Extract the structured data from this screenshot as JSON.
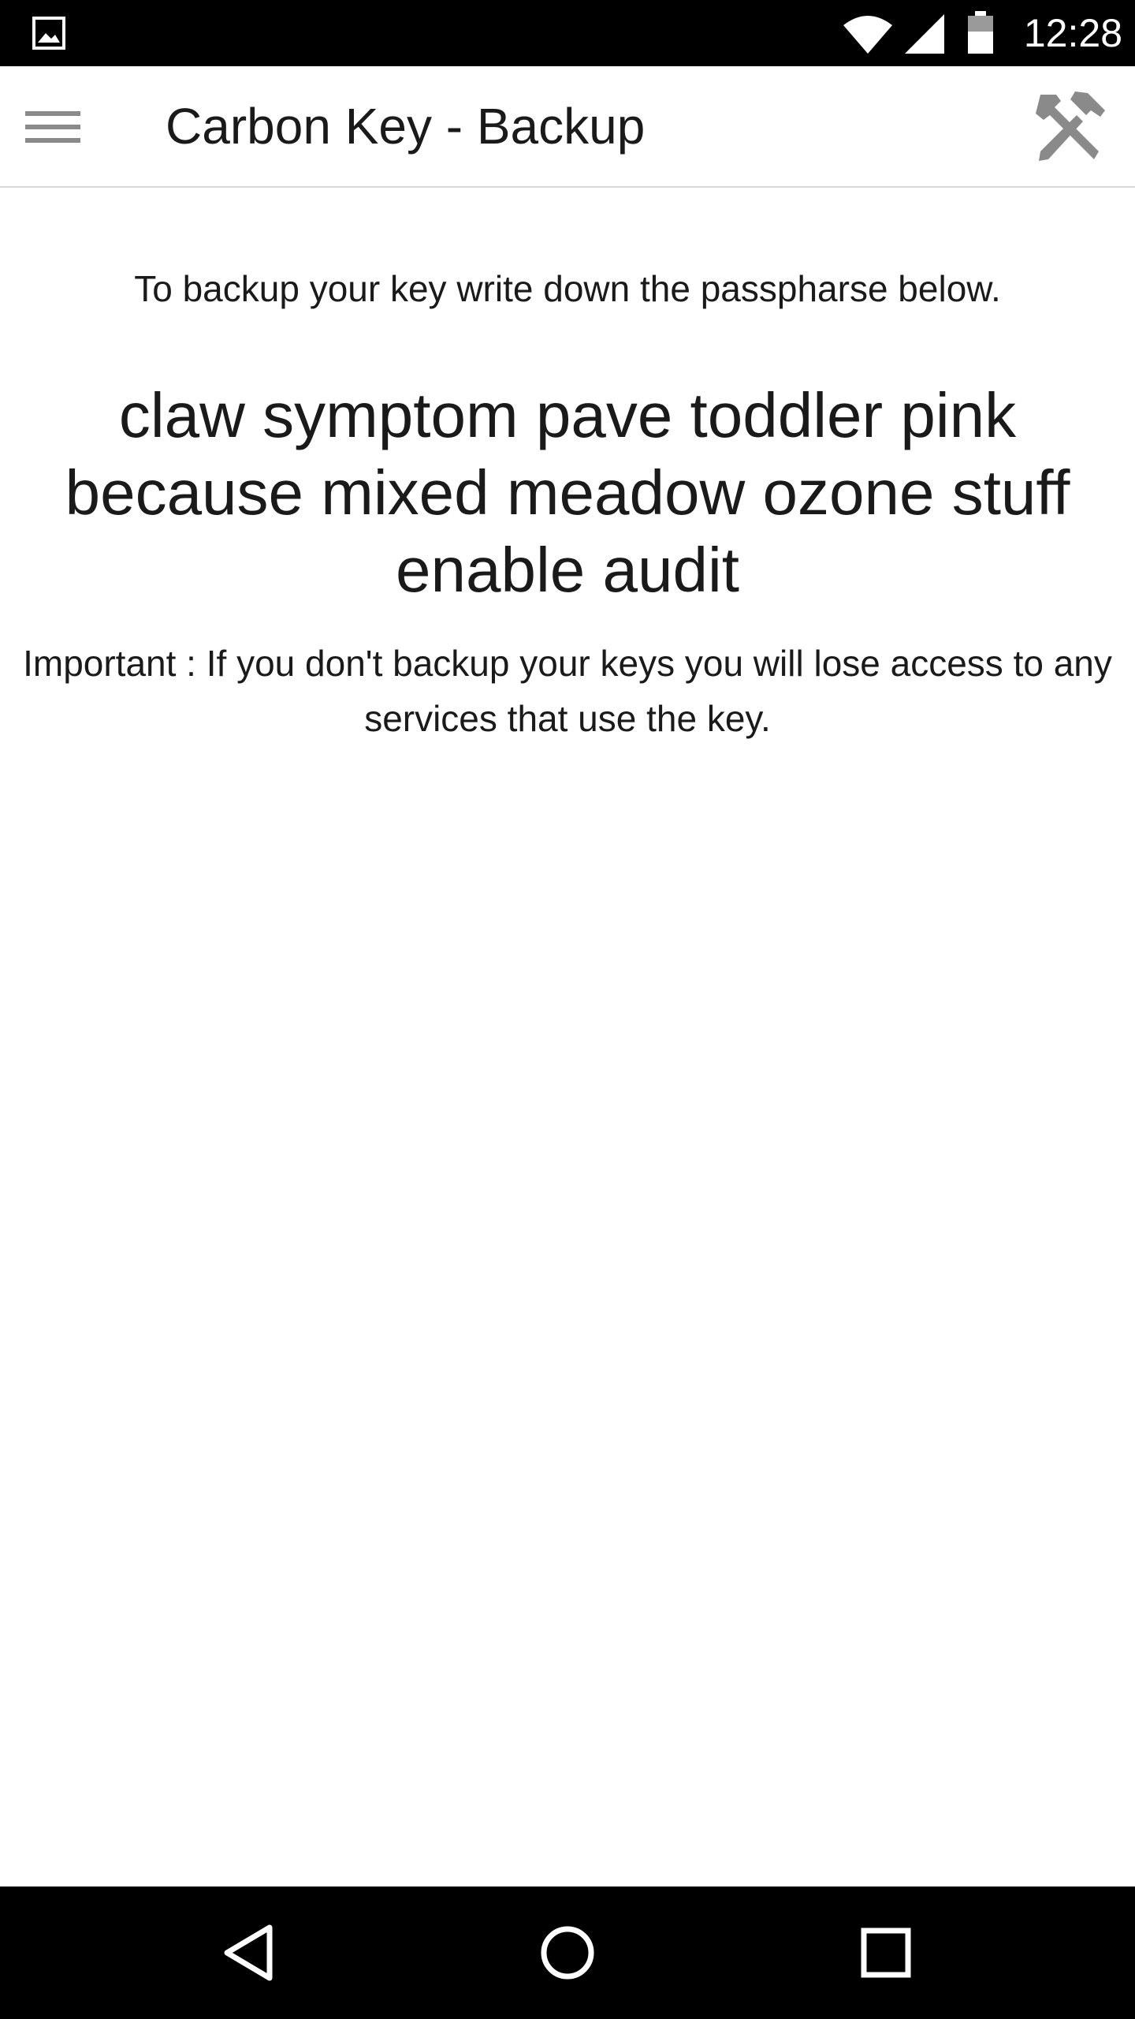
{
  "status_bar": {
    "time": "12:28",
    "icons": [
      "gallery-icon",
      "wifi-icon",
      "signal-icon",
      "battery-icon"
    ]
  },
  "app_bar": {
    "title": "Carbon Key - Backup",
    "menu_icon": "hamburger-menu-icon",
    "action_icon": "tools-icon"
  },
  "content": {
    "instruction": "To backup your key write down the passpharse below.",
    "passphrase": "claw symptom pave toddler pink because mixed meadow ozone stuff enable audit",
    "warning": "Important : If you don't backup your keys you will lose access to any services that use the key."
  },
  "nav_bar": {
    "icons": [
      "back-icon",
      "home-icon",
      "recents-icon"
    ]
  },
  "colors": {
    "status_bar_bg": "#000000",
    "nav_bar_bg": "#000000",
    "app_bar_bg": "#ffffff",
    "text": "#1a1a1a",
    "icon_gray": "#8a8a8a"
  }
}
